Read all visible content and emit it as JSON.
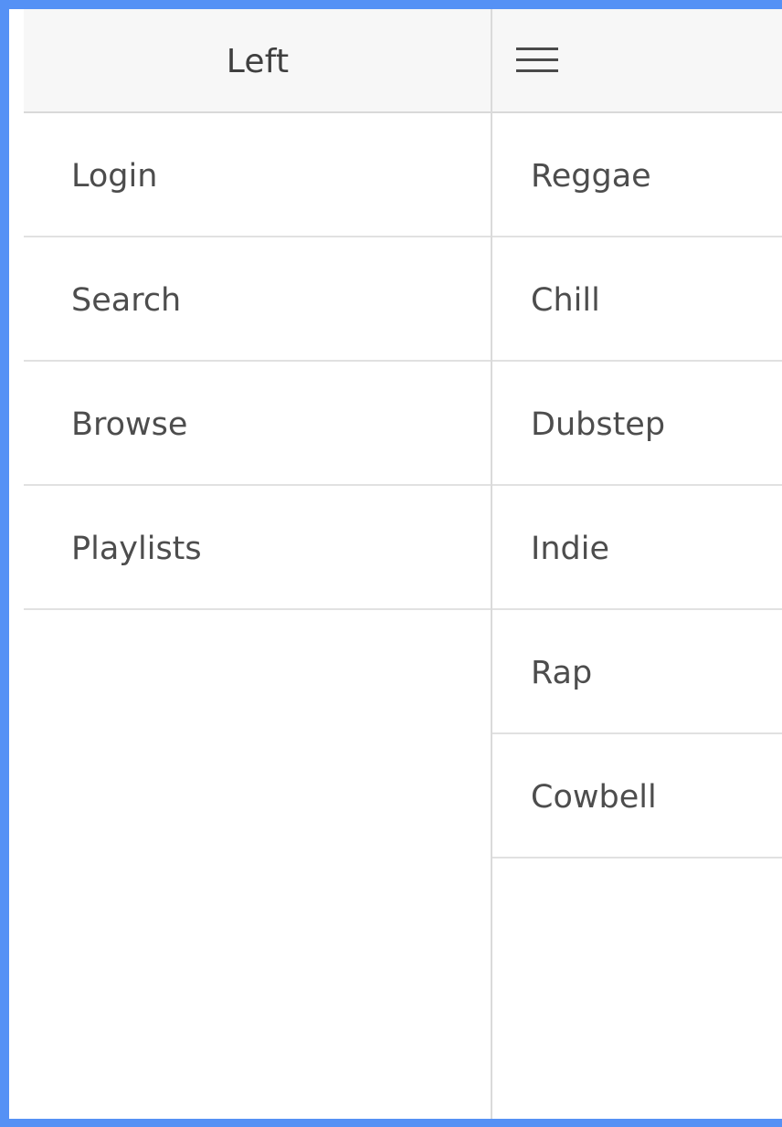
{
  "left_panel": {
    "title": "Left",
    "items": [
      {
        "label": "Login"
      },
      {
        "label": "Search"
      },
      {
        "label": "Browse"
      },
      {
        "label": "Playlists"
      }
    ]
  },
  "right_panel": {
    "menu_icon": "hamburger-menu-icon",
    "items": [
      {
        "label": "Reggae"
      },
      {
        "label": "Chill"
      },
      {
        "label": "Dubstep"
      },
      {
        "label": "Indie"
      },
      {
        "label": "Rap"
      },
      {
        "label": "Cowbell"
      }
    ]
  },
  "colors": {
    "frame": "#5591f5",
    "toolbar_background": "#f7f7f7",
    "divider": "#dadada",
    "text": "#4d4d4d"
  }
}
